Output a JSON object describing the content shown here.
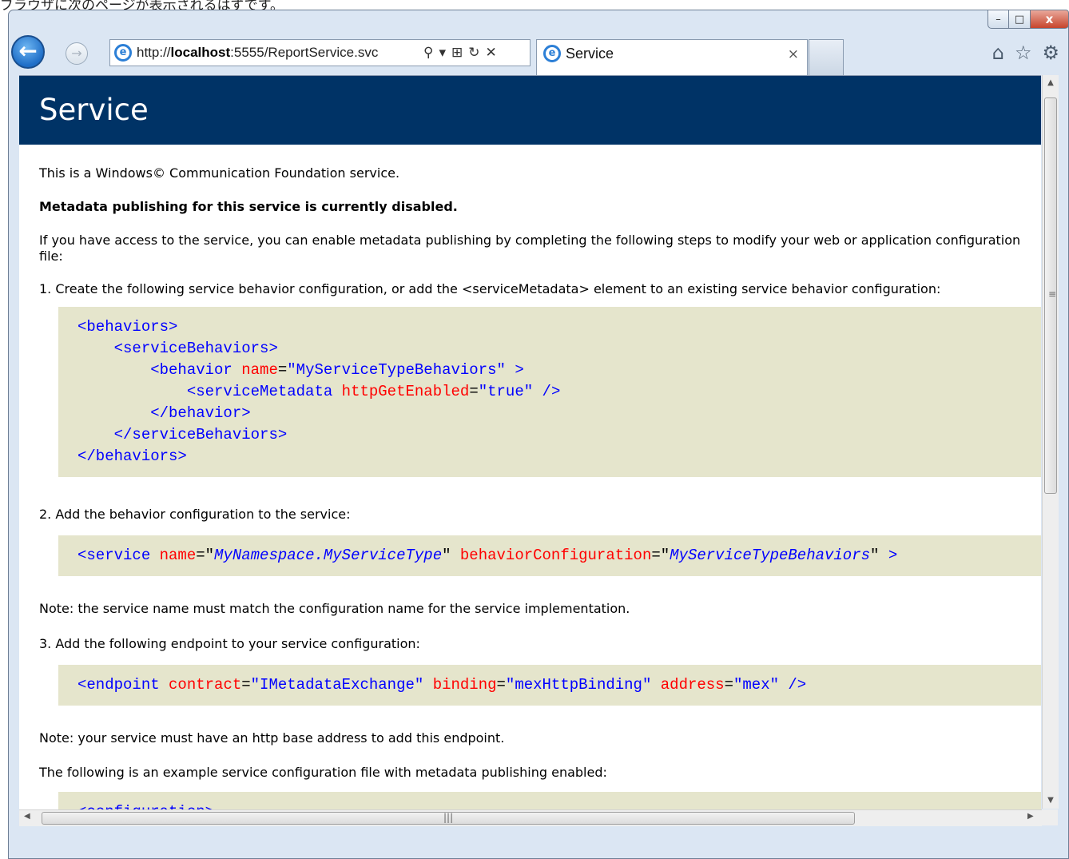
{
  "caption": "ブラウザに次のページが表示されるはずです。",
  "window": {
    "minimize_glyph": "–",
    "maximize_glyph": "□",
    "close_glyph": "x"
  },
  "nav": {
    "back_glyph": "←",
    "forward_glyph": "→"
  },
  "address_bar": {
    "url_prefix": "http://",
    "url_host": "localhost",
    "url_rest": ":5555/ReportService.svc",
    "search_glyph": "⚲",
    "dropdown_glyph": "▾",
    "compat_glyph": "⊞",
    "refresh_glyph": "↻",
    "stop_glyph": "✕"
  },
  "tab": {
    "title": "Service",
    "close_glyph": "×"
  },
  "toolbar_icons": [
    "home-icon",
    "favorites-star-icon",
    "tools-gear-icon"
  ],
  "page": {
    "title": "Service",
    "intro": "This is a Windows© Communication Foundation service.",
    "disabled_notice": "Metadata publishing for this service is currently disabled.",
    "access_text": "If you have access to the service, you can enable metadata publishing by completing the following steps to modify your web or application configuration file:",
    "step1": "1. Create the following service behavior configuration, or add the <serviceMetadata> element to an existing service behavior configuration:",
    "step2": "2. Add the behavior configuration to the service:",
    "note1": "Note: the service name must match the configuration name for the service implementation.",
    "step3": "3. Add the following endpoint to your service configuration:",
    "note2": "Note: your service must have an http base address to add this endpoint.",
    "example_text": "The following is an example service configuration file with metadata publishing enabled:"
  },
  "code": {
    "block1": [
      {
        "indent": "",
        "parts": [
          {
            "c": "tag",
            "t": "<behaviors>"
          }
        ]
      },
      {
        "indent": "    ",
        "parts": [
          {
            "c": "tag",
            "t": "<serviceBehaviors>"
          }
        ]
      },
      {
        "indent": "        ",
        "parts": [
          {
            "c": "tag",
            "t": "<behavior "
          },
          {
            "c": "attr",
            "t": "name"
          },
          {
            "c": "plain",
            "t": "="
          },
          {
            "c": "val",
            "t": "\"MyServiceTypeBehaviors\""
          },
          {
            "c": "tag",
            "t": " >"
          }
        ]
      },
      {
        "indent": "            ",
        "parts": [
          {
            "c": "tag",
            "t": "<serviceMetadata "
          },
          {
            "c": "attr",
            "t": "httpGetEnabled"
          },
          {
            "c": "plain",
            "t": "="
          },
          {
            "c": "val",
            "t": "\"true\""
          },
          {
            "c": "tag",
            "t": " />"
          }
        ]
      },
      {
        "indent": "        ",
        "parts": [
          {
            "c": "tag",
            "t": "</behavior>"
          }
        ]
      },
      {
        "indent": "    ",
        "parts": [
          {
            "c": "tag",
            "t": "</serviceBehaviors>"
          }
        ]
      },
      {
        "indent": "",
        "parts": [
          {
            "c": "tag",
            "t": "</behaviors>"
          }
        ]
      }
    ],
    "block2": [
      {
        "indent": "",
        "parts": [
          {
            "c": "tag",
            "t": "<service "
          },
          {
            "c": "attr",
            "t": "name"
          },
          {
            "c": "plain",
            "t": "=\""
          },
          {
            "c": "val-i",
            "t": "MyNamespace.MyServiceType"
          },
          {
            "c": "plain",
            "t": "\" "
          },
          {
            "c": "attr",
            "t": "behaviorConfiguration"
          },
          {
            "c": "plain",
            "t": "=\""
          },
          {
            "c": "val-i",
            "t": "MyServiceTypeBehaviors"
          },
          {
            "c": "plain",
            "t": "\" "
          },
          {
            "c": "tag",
            "t": ">"
          }
        ]
      }
    ],
    "block3": [
      {
        "indent": "",
        "parts": [
          {
            "c": "tag",
            "t": "<endpoint "
          },
          {
            "c": "attr",
            "t": "contract"
          },
          {
            "c": "plain",
            "t": "="
          },
          {
            "c": "val",
            "t": "\"IMetadataExchange\""
          },
          {
            "c": "attr",
            "t": " binding"
          },
          {
            "c": "plain",
            "t": "="
          },
          {
            "c": "val",
            "t": "\"mexHttpBinding\""
          },
          {
            "c": "attr",
            "t": " address"
          },
          {
            "c": "plain",
            "t": "="
          },
          {
            "c": "val",
            "t": "\"mex\""
          },
          {
            "c": "tag",
            "t": " />"
          }
        ]
      }
    ],
    "block4": [
      {
        "indent": "",
        "parts": [
          {
            "c": "tag",
            "t": "<configuration>"
          }
        ]
      }
    ]
  },
  "scrollbars": {
    "up_glyph": "▲",
    "down_glyph": "▼",
    "left_glyph": "◀",
    "right_glyph": "▶",
    "v_grip": "≡",
    "h_grip": "|||"
  },
  "colors": {
    "header_bg": "#003366",
    "code_bg": "#e5e5cc",
    "code_tag": "#0000ff",
    "code_attr": "#ff0000"
  }
}
